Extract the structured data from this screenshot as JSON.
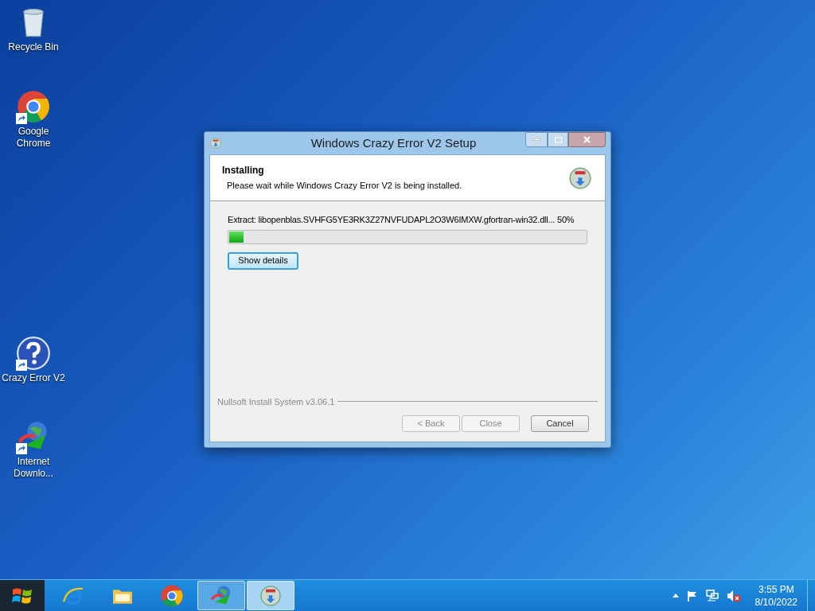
{
  "desktop_icons": [
    {
      "kind": "recycle",
      "label": "Recycle Bin",
      "shortcut": false
    },
    {
      "kind": "chrome",
      "label": "Google Chrome",
      "shortcut": true
    },
    {
      "kind": "question",
      "label": "Crazy Error V2",
      "shortcut": true
    },
    {
      "kind": "globe",
      "label": "Internet Downlo...",
      "shortcut": true
    }
  ],
  "window": {
    "title": "Windows Crazy Error V2 Setup",
    "header": {
      "title": "Installing",
      "subtitle": "Please wait while Windows Crazy Error V2 is being installed."
    },
    "status": "Extract: libopenblas.SVHFG5YE3RK3Z27NVFUDAPL2O3W6IMXW.gfortran-win32.dll... 50%",
    "progress": {
      "level": 0.04
    },
    "details_button": "Show details",
    "branding": "Nullsoft Install System v3.06.1",
    "buttons": [
      {
        "label": "< Back",
        "disabled": true
      },
      {
        "label": "Close",
        "disabled": true
      },
      {
        "label": "Cancel",
        "disabled": false
      }
    ]
  },
  "taskbar": {
    "items": [
      {
        "kind": "ie",
        "selected": false,
        "running": false
      },
      {
        "kind": "folder",
        "selected": false,
        "running": false
      },
      {
        "kind": "chrome",
        "selected": false,
        "running": false
      },
      {
        "kind": "globe",
        "selected": false,
        "running": true
      },
      {
        "kind": "setup",
        "selected": true,
        "running": true
      }
    ],
    "tray": {
      "volume_muted": true
    },
    "time": "3:55 PM",
    "date": "8/10/2022"
  }
}
